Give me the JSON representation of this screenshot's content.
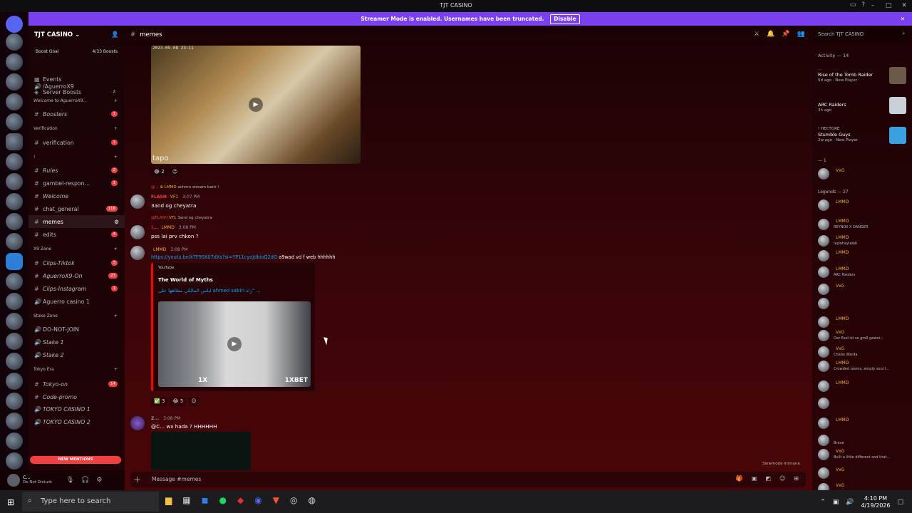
{
  "window": {
    "title": "TJT CASINO"
  },
  "streamer_banner": {
    "text": "Streamer Mode is enabled. Usernames have been truncated.",
    "button": "Disable"
  },
  "server": {
    "name": "TJT CASINO",
    "boost_goal": "Boost Goal",
    "boost_count": "4/33 Boosts"
  },
  "sidebar": {
    "top_items": [
      {
        "label": "Events",
        "icon": "calendar-icon"
      },
      {
        "label": "Server Boosts",
        "icon": "boost-icon",
        "count": "2"
      }
    ],
    "channels": [
      {
        "label": "/AguerroX9",
        "type": "voice"
      },
      {
        "label": "Welcome to AguerroX9...",
        "type": "category"
      },
      {
        "label": "Boosters",
        "count": "1",
        "italic": true
      },
      {
        "label": "Verification",
        "type": "category"
      },
      {
        "label": "verification",
        "count": "1"
      },
      {
        "label": "!",
        "type": "category"
      },
      {
        "label": "Rules",
        "count": "2",
        "italic": true
      },
      {
        "label": "gambel-respon...",
        "count": "1"
      },
      {
        "label": "Welcome",
        "italic": true
      },
      {
        "label": "chat_general",
        "count": "116"
      },
      {
        "label": "memes",
        "active": true
      },
      {
        "label": "edits",
        "count": "4"
      },
      {
        "label": "X9 Zone",
        "type": "category"
      },
      {
        "label": "Clips-Tiktok",
        "count": "3",
        "italic": true
      },
      {
        "label": "AguerroX9-On",
        "count": "27",
        "italic": true
      },
      {
        "label": "Clips-Instagram",
        "count": "1",
        "italic": true
      },
      {
        "label": "Aguerro casino 1",
        "type": "voice"
      },
      {
        "label": "Stake Zone",
        "type": "category"
      },
      {
        "label": "DO-NOT-JOIN",
        "type": "voice"
      },
      {
        "label": "Stake 1",
        "type": "voice",
        "italic": true
      },
      {
        "label": "Stake 2",
        "type": "voice",
        "italic": true
      },
      {
        "label": "Tokyo Era",
        "type": "category"
      },
      {
        "label": "Tokyo-on",
        "count": "14",
        "italic": true
      },
      {
        "label": "Code-promo",
        "italic": true
      },
      {
        "label": "TOKYO CASINO 1",
        "type": "voice",
        "italic": true
      },
      {
        "label": "TOKYO CASINO 2",
        "type": "voice",
        "italic": true
      }
    ],
    "new_mentions": "NEW MENTIONS"
  },
  "user_panel": {
    "name": "C...",
    "status": "Do Not Disturb"
  },
  "channel_header": {
    "name": "memes"
  },
  "search": {
    "placeholder": "Search TJT CASINO"
  },
  "messages": {
    "media1": {
      "timestamp": "2023-05-08 23:11",
      "watermark": "tapo",
      "reaction_count": "2"
    },
    "msg1": {
      "reply_user": "@...",
      "reply_text": "achmn stream bant !",
      "user": "FLASH",
      "tag": "VF1",
      "time": "3:07 PM",
      "text": "3and og cheyatra"
    },
    "msg2": {
      "reply_user": "@FLASH",
      "reply_tag": "VF1",
      "reply_text": "3and og cheyatra",
      "user": "!...",
      "tag": "LMMD",
      "time": "3:08 PM",
      "text": "pss lai prv chkon ?"
    },
    "msg3": {
      "tag": "LMMD",
      "time": "3:08 PM",
      "link": "https://youtu.be/kTF9SK07dXs?si=YP11cyoJdbioQ2dG",
      "text_after": "a9wad vd f web hhhhhh"
    },
    "embed": {
      "provider": "YouTube",
      "title": "The World of Myths",
      "description": "لباس المالكي مطاهها على ahmed sabiri زاه\" ...",
      "brand": "1XBET",
      "brand2": "1X"
    },
    "embed_reactions": [
      {
        "emoji": "✅",
        "count": "3"
      },
      {
        "emoji": "😂",
        "count": "5"
      }
    ],
    "msg4": {
      "user": "Z...",
      "time": "3:08 PM",
      "text": "@C... wx hada ? HHHHHH"
    }
  },
  "slowmode": "Slowmode Immune",
  "composer": {
    "placeholder": "Message #memes"
  },
  "members": {
    "activity_title": "Activity — 14",
    "activity": [
      {
        "user": "...",
        "game": "Rise of the Tomb Raider",
        "meta": "5d ago · New Player",
        "color": "#6b5a4a"
      },
      {
        "user": "...",
        "game": "ARC Raiders",
        "meta": "3h ago",
        "color": "#c8d0d8"
      },
      {
        "user": "! HECTORE",
        "game": "Stumble Guys",
        "meta": "2w ago · New Player",
        "color": "#3aa0e0"
      }
    ],
    "group_hidden": "— 1",
    "group_legends": "Legends — 27",
    "rows": [
      {
        "name": "VxG",
        "sub": ""
      },
      {
        "name": "LMMD",
        "sub": ""
      },
      {
        "name": "LMMD",
        "sub": "REYNOX X DANGER"
      },
      {
        "name": "LMMD",
        "sub": "laylahaylalah"
      },
      {
        "name": "LMMD",
        "sub": ""
      },
      {
        "name": "LMMD",
        "sub": "ARC Raiders"
      },
      {
        "name": "VxG",
        "sub": ""
      },
      {
        "name": "",
        "sub": ""
      },
      {
        "name": "LMMD",
        "sub": ""
      },
      {
        "name": "VxG",
        "sub": "Der Esel ist so groß gewor..."
      },
      {
        "name": "VxG",
        "sub": "Cheba Warda"
      },
      {
        "name": "LMMD",
        "sub": "Crowded rooms, empty soul l..."
      },
      {
        "name": "LMMD",
        "sub": ""
      },
      {
        "name": "",
        "sub": ""
      },
      {
        "name": "LMMD",
        "sub": ""
      },
      {
        "name": "",
        "sub": "Brave"
      },
      {
        "name": "VxG",
        "sub": "Built a little different and that..."
      },
      {
        "name": "VxG",
        "sub": ""
      },
      {
        "name": "VxG",
        "sub": ""
      }
    ]
  },
  "taskbar": {
    "search_placeholder": "Type here to search",
    "time": "4:10 PM",
    "date": "4/19/2026"
  }
}
